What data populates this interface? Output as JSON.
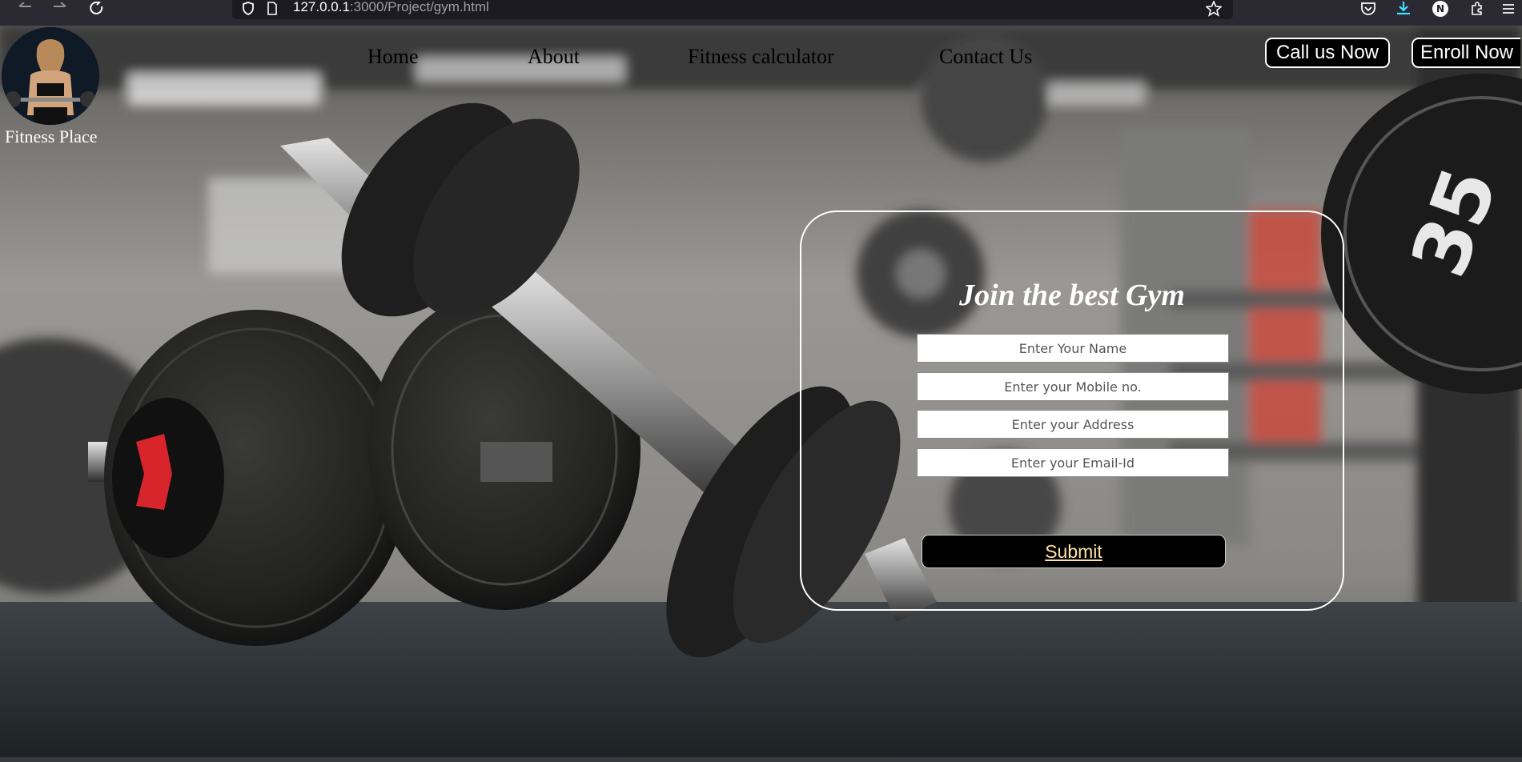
{
  "browser": {
    "url_host": "127.0.0.1",
    "url_path": ":3000/Project/gym.html",
    "profile_initial": "N"
  },
  "site": {
    "logo_text": "Fitness Place",
    "nav": [
      {
        "label": "Home"
      },
      {
        "label": "About"
      },
      {
        "label": "Fitness calculator"
      },
      {
        "label": "Contact Us"
      }
    ],
    "call_button": "Call us Now",
    "enroll_button": "Enroll Now"
  },
  "form": {
    "title": "Join the best Gym",
    "fields": [
      {
        "placeholder": "Enter Your Name"
      },
      {
        "placeholder": "Enter your Mobile no."
      },
      {
        "placeholder": "Enter your Address"
      },
      {
        "placeholder": "Enter your Email-Id"
      }
    ],
    "submit_label": "Submit"
  },
  "background": {
    "plate_number": "35"
  },
  "colors": {
    "browser_chrome": "#2b2a33",
    "url_field": "#1c1b22",
    "download_accent": "#3fe1ff",
    "submit_text": "#ffe3a6",
    "accent_red": "#d8252c"
  }
}
